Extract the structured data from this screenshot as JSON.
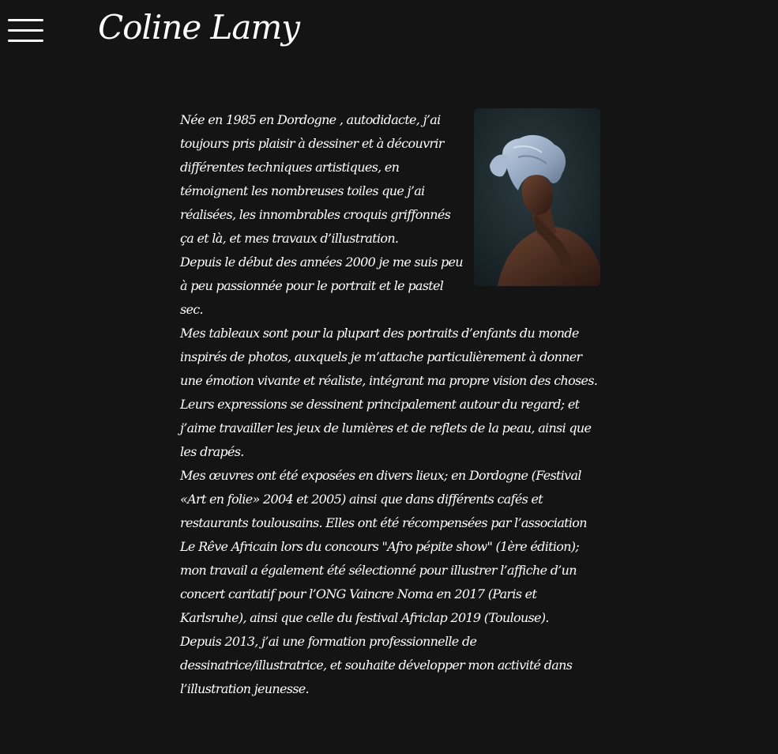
{
  "header": {
    "menu_icon": "hamburger-menu-icon",
    "site_title": "Coline Lamy"
  },
  "portrait": {
    "icon": "portrait-painting",
    "background_color": "#1c2a2e",
    "wrap_color": "#9fb2c9"
  },
  "bio": {
    "paragraphs": [
      "Née en 1985 en Dordogne , autodidacte, j’ai toujours pris plaisir à dessiner et à découvrir différentes techniques artistiques, en témoignent les nombreuses toiles que j’ai réalisées, les innombrables croquis griffonnés ça et là, et mes travaux d’illustration.",
      "Depuis le début des années 2000 je me suis peu à peu passionnée pour le portrait et le pastel sec.",
      "Mes tableaux sont pour la plupart des portraits d’enfants du monde inspirés de photos, auxquels je m’attache particulièrement à donner une émotion vivante et réaliste, intégrant ma propre vision des choses. Leurs expressions se dessinent principalement autour du regard; et j’aime travailler les jeux de lumières et de reflets de la peau, ainsi que les drapés.",
      "Mes œuvres ont été exposées en divers lieux; en Dordogne (Festival «Art en folie» 2004 et 2005) ainsi que dans différents cafés et restaurants toulousains. Elles ont été récompensées par l’association Le Rêve Africain lors du concours \"Afro pépite show\" (1ère édition); mon travail a également été sélectionné pour illustrer l’affiche d’un concert caritatif pour l’ONG Vaincre Noma en 2017 (Paris et Karlsruhe), ainsi que celle du festival Africlap 2019 (Toulouse).",
      "Depuis 2013, j’ai une formation professionnelle de dessinatrice/illustratrice, et souhaite développer mon activité dans l’illustration jeunesse."
    ]
  }
}
